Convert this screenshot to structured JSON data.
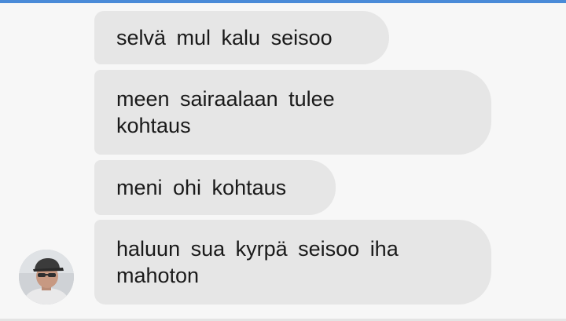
{
  "colors": {
    "bubble_background": "#e6e6e6",
    "page_background": "#f7f7f7",
    "top_accent": "#4a8bd8",
    "text": "#1a1a1a"
  },
  "chat": {
    "messages": [
      {
        "text": "selvä mul kalu seisoo"
      },
      {
        "text": "meen sairaalaan tulee\nkohtaus"
      },
      {
        "text": "meni ohi kohtaus"
      },
      {
        "text": "haluun sua kyrpä seisoo iha\nmahoton"
      }
    ]
  },
  "sender_avatar": {
    "icon": "user-avatar-photo"
  }
}
